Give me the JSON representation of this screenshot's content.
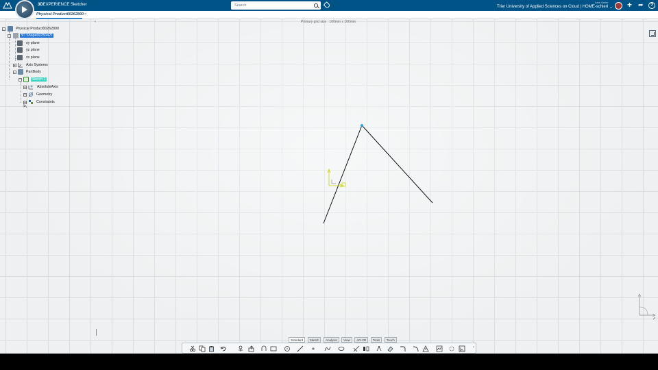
{
  "app": {
    "brand": "3D",
    "brand_rest": "EXPERIENCE",
    "app_name": "Sketcher"
  },
  "search": {
    "placeholder": "Search"
  },
  "user": {
    "name": "Lars Sarier"
  },
  "tenant": {
    "label": "Trier University of Applied Sciences on Cloud | HOME-schierl"
  },
  "tab": {
    "title": "Physical Product00262800",
    "close": "×"
  },
  "viewport": {
    "grid_label": "Primary grid size : 100mm x 100mm"
  },
  "tree": {
    "root": "Physical Product00262800",
    "shape": "3D Shape00250421",
    "xy": "xy plane",
    "yz": "yz plane",
    "zx": "zx plane",
    "axis_systems": "Axis Systems",
    "partbody": "PartBody",
    "sketch": "Sketch.1",
    "absolute_axis": "AbsoluteAxis",
    "geometry": "Geometry",
    "constraints": "Constraints"
  },
  "section_tabs": [
    "Standard",
    "Sketch",
    "Analysis",
    "View",
    "AR-VR",
    "Tools",
    "Touch"
  ],
  "colors": {
    "topbar": "#005386",
    "highlight_blue": "#1a6fd6",
    "highlight_teal": "#3fd1c0",
    "sketch_point": "#2aa3e8",
    "origin": "#c9d400"
  }
}
